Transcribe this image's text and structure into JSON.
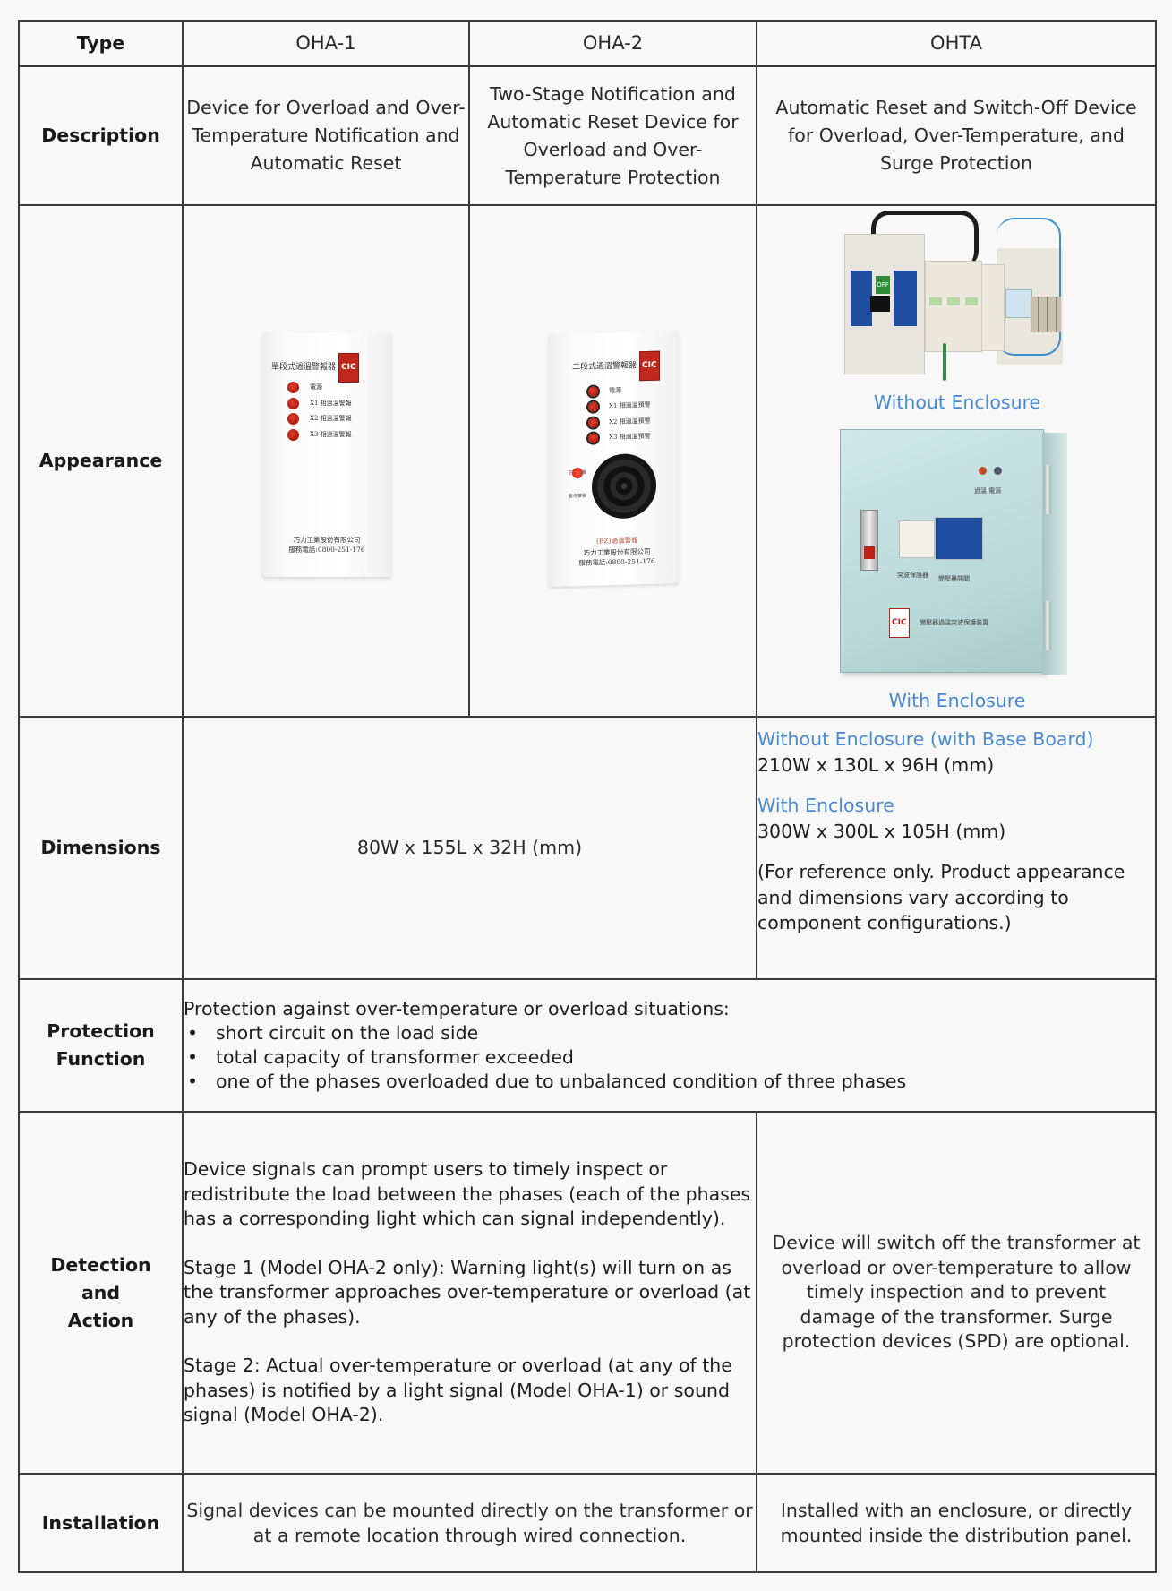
{
  "table": {
    "header": {
      "type_label": "Type",
      "models": [
        "OHA-1",
        "OHA-2",
        "OHTA"
      ]
    },
    "description": {
      "label": "Description",
      "oha1": "Device for Overload and Over-Temperature Notification and Automatic Reset",
      "oha2": "Two-Stage Notification and Automatic Reset Device for Overload and Over-Temperature Protection",
      "ohta": "Automatic Reset and Switch-Off Device for Overload, Over-Temperature, and Surge Protection"
    },
    "appearance": {
      "label": "Appearance",
      "oha1_image": {
        "title": "單段式過溫警報器",
        "brand": "CIC",
        "lights": [
          "電源",
          "X1 相過溫警報",
          "X2 相過溫警報",
          "X3 相過溫警報"
        ],
        "company": "巧力工業股份有限公司",
        "phone": "服務電話:0800-251-176"
      },
      "oha2_image": {
        "title": "二段式過溫警報器",
        "brand": "CIC",
        "lights": [
          "電源",
          "X1 相過溫預警",
          "X2 相過溫預警",
          "X3 相過溫預警"
        ],
        "knob_top": "正常位置",
        "knob_bottom": "暫停警報",
        "buzzer_label": "(BZ)過溫警報",
        "company": "巧力工業股份有限公司",
        "phone": "服務電話:0800-251-176"
      },
      "ohta_images": {
        "without_label": "Without Enclosure",
        "with_label": "With Enclosure",
        "breaker_text": "OFF",
        "enclosure_lamps": "過溫 電源",
        "enclosure_spd": "突波保護器",
        "enclosure_breaker": "變壓器開關",
        "enclosure_brand": "CIC",
        "enclosure_title": "變壓器過溫突波保護裝置"
      }
    },
    "dimensions": {
      "label": "Dimensions",
      "oha": "80W x 155L x 32H (mm)",
      "ohta_without_heading": "Without Enclosure (with Base Board)",
      "ohta_without_value": "210W x 130L x 96H (mm)",
      "ohta_with_heading": "With Enclosure",
      "ohta_with_value": "300W x 300L x 105H (mm)",
      "ohta_note": "(For reference only. Product appearance and dimensions vary according to component configurations.)"
    },
    "protection": {
      "label_line1": "Protection",
      "label_line2": "Function",
      "intro": "Protection against over-temperature or overload situations:",
      "bullets": [
        "short circuit on the load side",
        "total capacity of transformer exceeded",
        "one of the phases overloaded due to unbalanced condition of three phases"
      ]
    },
    "detection": {
      "label_line1": "Detection",
      "label_line2": "and",
      "label_line3": "Action",
      "oha_paragraphs": [
        "Device signals can prompt users to timely inspect or redistribute the load between the phases (each of the phases has a corresponding light which can signal independently).",
        "Stage 1 (Model OHA-2 only): Warning light(s) will turn on as the transformer approaches over-temperature or overload (at any of the phases).",
        "Stage 2: Actual over-temperature or overload (at any of the phases) is notified by a light signal (Model OHA-1) or sound signal (Model OHA-2)."
      ],
      "ohta": "Device will switch off the transformer at overload or over-temperature to allow timely inspection and to prevent damage of the transformer. Surge protection devices (SPD) are optional."
    },
    "installation": {
      "label": "Installation",
      "oha": "Signal devices can be mounted directly on the transformer or at a remote location through wired connection.",
      "ohta": "Installed with an enclosure, or directly mounted inside the distribution panel."
    }
  },
  "colors": {
    "accent_blue": "#4a8ad4",
    "border": "#3a3a3a",
    "background": "#f8f8f8"
  }
}
